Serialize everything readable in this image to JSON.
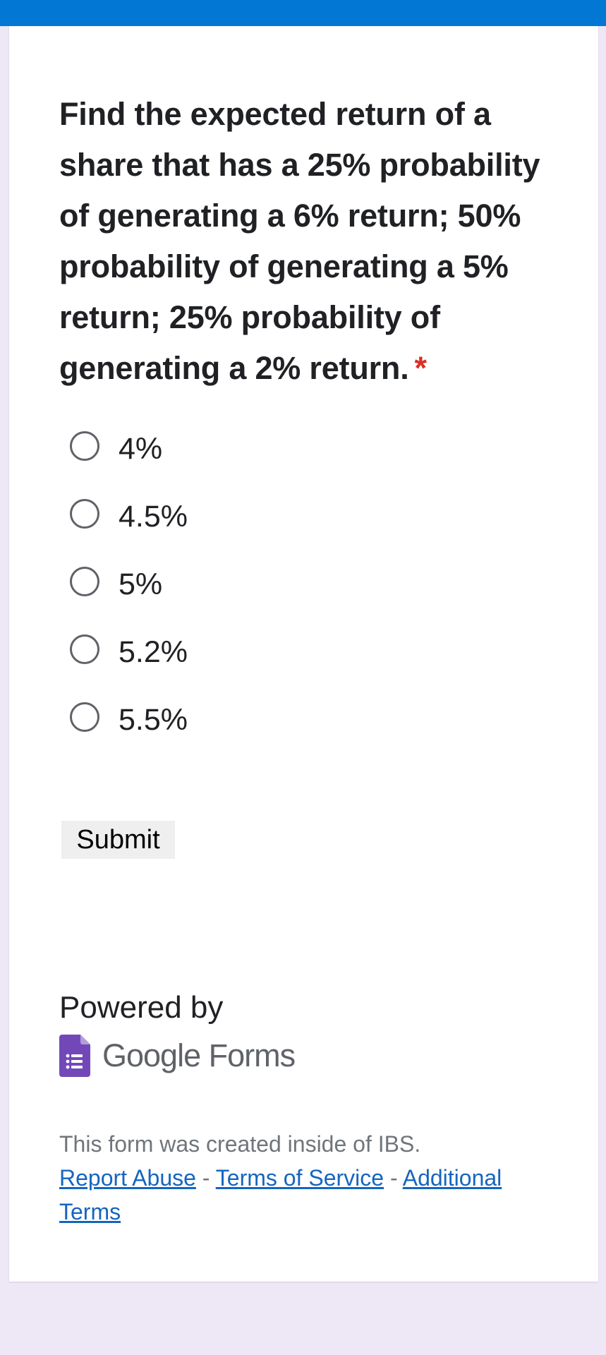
{
  "question": {
    "text": "Find the expected return of a\nshare that has a 25% probability\nof generating a 6% return;  50%\nprobability of generating a 5%\nreturn; 25% probability of\ngenerating a 2% return.",
    "required_marker": "*"
  },
  "options": [
    {
      "label": "4%"
    },
    {
      "label": "4.5%"
    },
    {
      "label": "5%"
    },
    {
      "label": "5.2%"
    },
    {
      "label": "5.5%"
    }
  ],
  "submit_label": "Submit",
  "footer": {
    "powered_by": "Powered by",
    "brand_google": "Google",
    "brand_forms": "Forms",
    "note": "This form was created inside of IBS.",
    "links": {
      "report_abuse": "Report Abuse",
      "separator": "-",
      "terms_of_service": "Terms of Service",
      "additional_terms": "Additional Terms"
    }
  },
  "colors": {
    "top_bar": "#0277d4",
    "page_background": "#ede7f6",
    "required": "#d93025",
    "link": "#1565c0",
    "forms_icon": "#7248b9"
  },
  "icons": {
    "forms_logo": "google-forms-icon",
    "radio": "radio-unchecked-icon"
  }
}
